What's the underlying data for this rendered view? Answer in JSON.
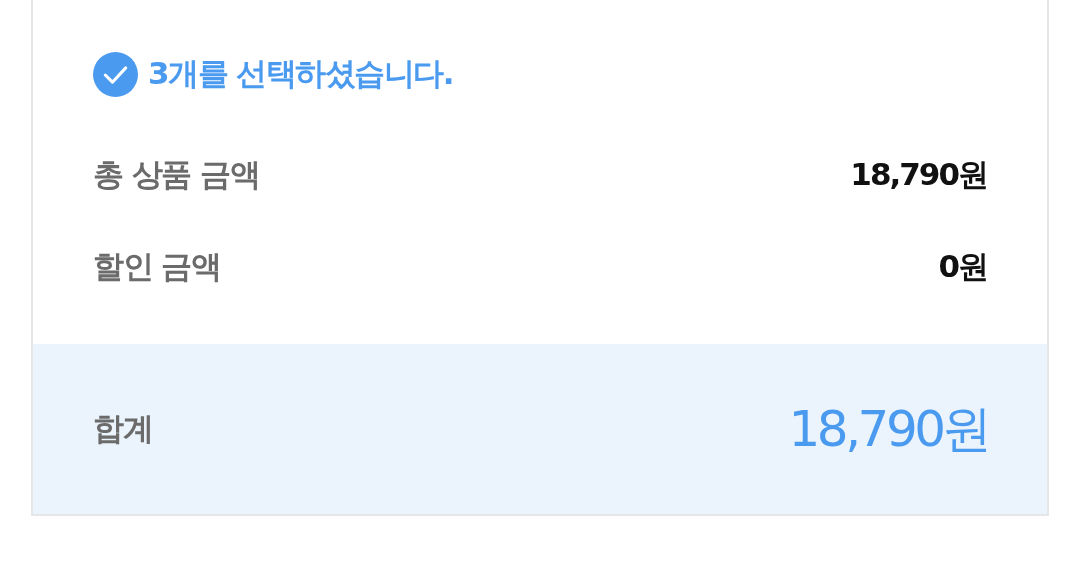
{
  "selection": {
    "checked": true,
    "message": "3개를 선택하셨습니다."
  },
  "rows": [
    {
      "label": "총 상품 금액",
      "value": "18,790원"
    },
    {
      "label": "할인 금액",
      "value": "0원"
    }
  ],
  "total": {
    "label": "합계",
    "value": "18,790원"
  }
}
